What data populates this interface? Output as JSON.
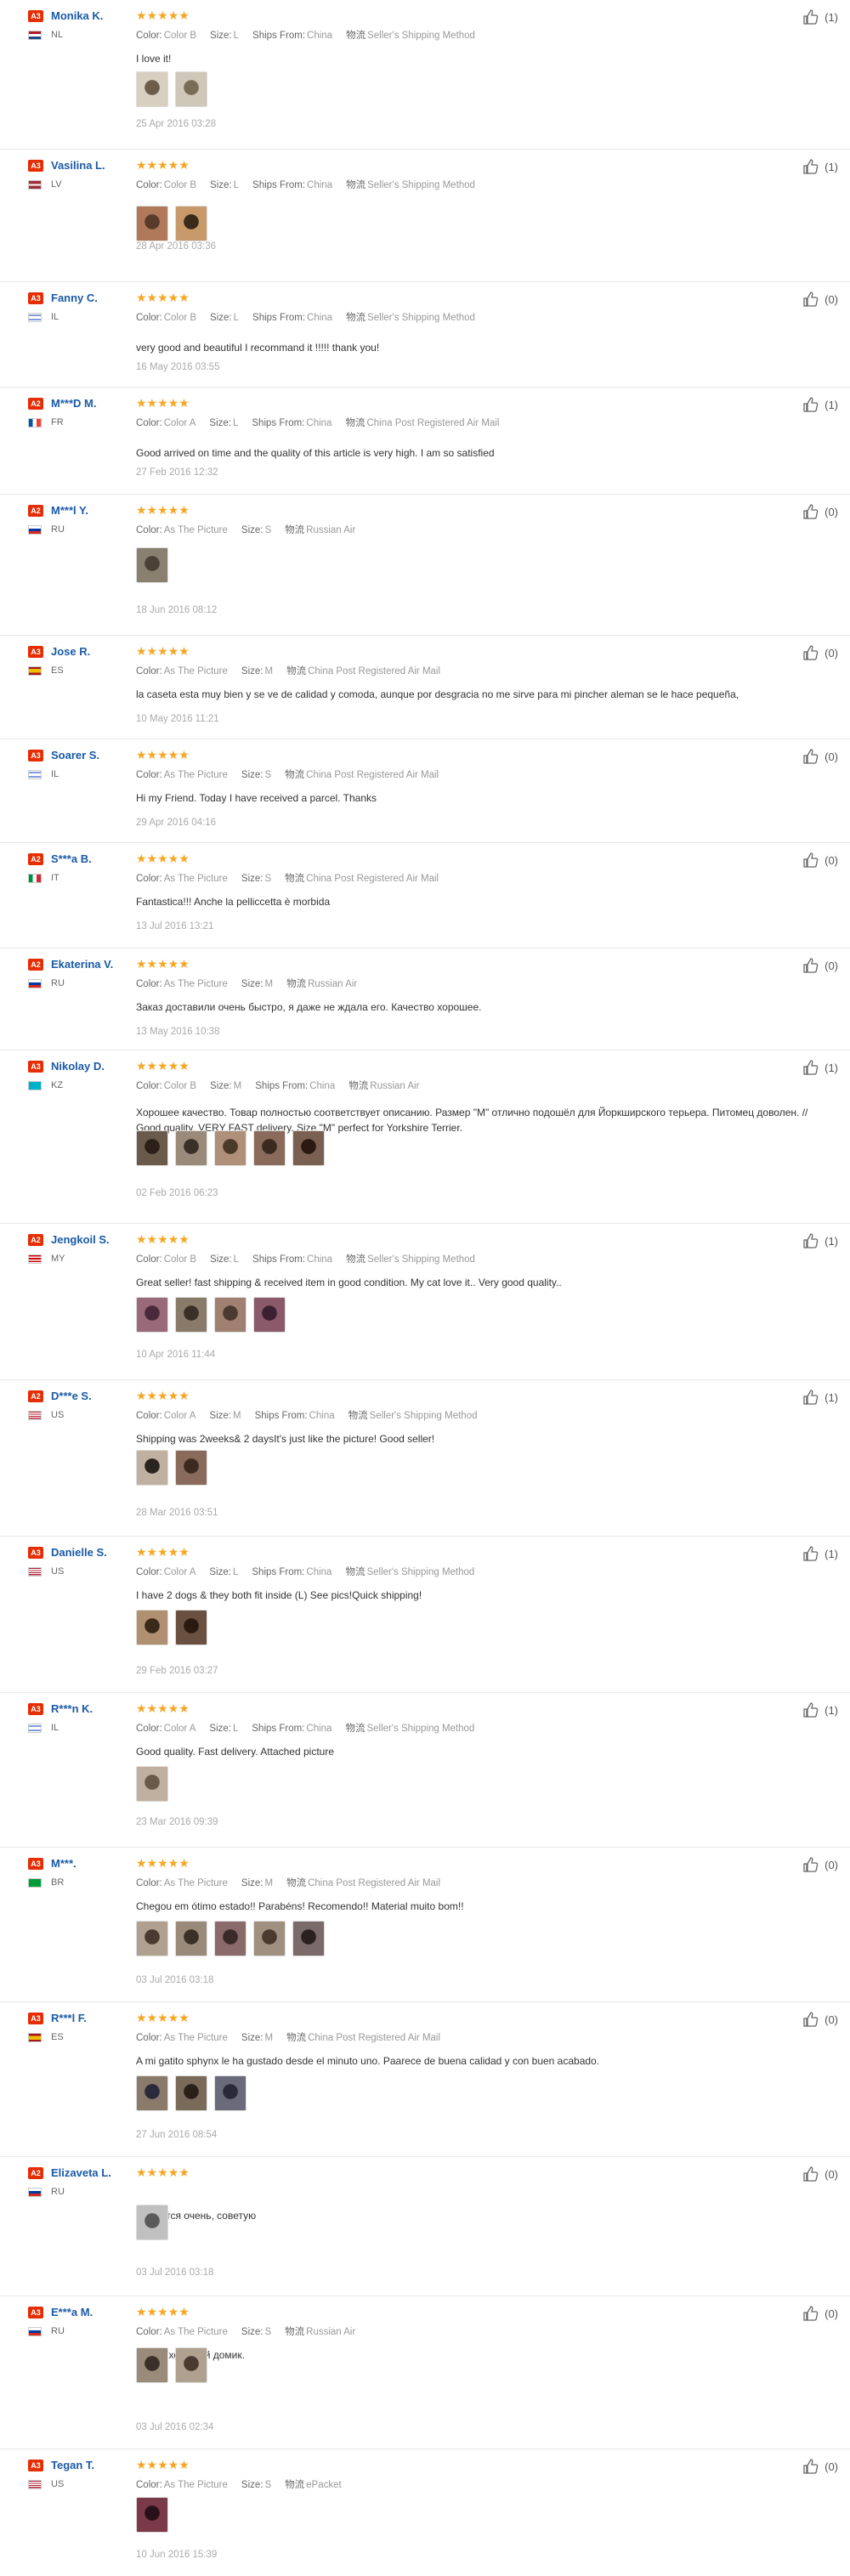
{
  "colors": {
    "badge": "#e62e04",
    "name": "#1a5aa6",
    "star": "#f5a623",
    "meta": "#999999"
  },
  "labels": {
    "color": "Color:",
    "size": "Size:",
    "ships_from": "Ships From:",
    "method_prefix": "物流"
  },
  "reviews": [
    {
      "badge": "A3",
      "name": "Monika K.",
      "country": "NL",
      "flag": "nl",
      "stars": "★★★★★",
      "color": "Color B",
      "size": "L",
      "ships_from": "China",
      "method": "Seller's Shipping Method",
      "text": "I love it!",
      "thumbs": [
        {
          "c1": "#d8cfc1",
          "c2": "#6b5d4a"
        },
        {
          "c1": "#cfc7b8",
          "c2": "#7a6d58"
        }
      ],
      "date": "25 Apr 2016 03:28",
      "helpful": "(1)"
    },
    {
      "badge": "A3",
      "name": "Vasilina L.",
      "country": "LV",
      "flag": "lv",
      "stars": "★★★★★",
      "color": "Color B",
      "size": "L",
      "ships_from": "China",
      "method": "Seller's Shipping Method",
      "text": "",
      "thumbs": [
        {
          "c1": "#b07a5a",
          "c2": "#5a3a2a"
        },
        {
          "c1": "#c89a6a",
          "c2": "#3a2a1a"
        }
      ],
      "date": "28 Apr 2016 03:36",
      "helpful": "(1)"
    },
    {
      "badge": "A3",
      "name": "Fanny C.",
      "country": "IL",
      "flag": "il",
      "stars": "★★★★★",
      "color": "Color B",
      "size": "L",
      "ships_from": "China",
      "method": "Seller's Shipping Method",
      "text": "very good and beautiful I recommand it !!!!! thank you!",
      "thumbs": [],
      "date": "16 May 2016 03:55",
      "helpful": "(0)"
    },
    {
      "badge": "A2",
      "name": "M***D M.",
      "country": "FR",
      "flag": "fr",
      "stars": "★★★★★",
      "color": "Color A",
      "size": "L",
      "ships_from": "China",
      "method": "China Post Registered Air Mail",
      "text": "Good arrived on time and the quality of this article is very high. I am so satisfied",
      "thumbs": [],
      "date": "27 Feb 2016 12:32",
      "helpful": "(1)"
    },
    {
      "badge": "A2",
      "name": "M***l Y.",
      "country": "RU",
      "flag": "ru",
      "stars": "★★★★★",
      "color": "As The Picture",
      "size": "S",
      "ships_from": "",
      "method": "Russian Air",
      "text": "",
      "thumbs": [
        {
          "c1": "#8a8070",
          "c2": "#4a4036"
        }
      ],
      "date": "18 Jun 2016 08:12",
      "helpful": "(0)"
    },
    {
      "badge": "A3",
      "name": "Jose R.",
      "country": "ES",
      "flag": "es",
      "stars": "★★★★★",
      "color": "As The Picture",
      "size": "M",
      "ships_from": "",
      "method": "China Post Registered Air Mail",
      "text": "la caseta esta muy bien y se ve de calidad y comoda, aunque por desgracia no me sirve para mi pincher aleman se le hace pequeña,",
      "thumbs": [],
      "date": "10 May 2016 11:21",
      "helpful": "(0)"
    },
    {
      "badge": "A3",
      "name": "Soarer S.",
      "country": "IL",
      "flag": "il",
      "stars": "★★★★★",
      "color": "As The Picture",
      "size": "S",
      "ships_from": "",
      "method": "China Post Registered Air Mail",
      "text": "Hi my Friend. Today I have received a parcel. Thanks",
      "thumbs": [],
      "date": "29 Apr 2016 04:16",
      "helpful": "(0)"
    },
    {
      "badge": "A2",
      "name": "S***a B.",
      "country": "IT",
      "flag": "it",
      "stars": "★★★★★",
      "color": "As The Picture",
      "size": "S",
      "ships_from": "",
      "method": "China Post Registered Air Mail",
      "text": "Fantastica!!! Anche la pelliccetta è morbida",
      "thumbs": [],
      "date": "13 Jul 2016 13:21",
      "helpful": "(0)"
    },
    {
      "badge": "A2",
      "name": "Ekaterina V.",
      "country": "RU",
      "flag": "ru",
      "stars": "★★★★★",
      "color": "As The Picture",
      "size": "M",
      "ships_from": "",
      "method": "Russian Air",
      "text": "Заказ доставили очень быстро, я даже не ждала его. Качество хорошее.",
      "thumbs": [],
      "date": "13 May 2016 10:38",
      "helpful": "(0)"
    },
    {
      "badge": "A3",
      "name": "Nikolay D.",
      "country": "KZ",
      "flag": "kz",
      "stars": "★★★★★",
      "color": "Color B",
      "size": "M",
      "ships_from": "China",
      "method": "Russian Air",
      "text": "Хорошее качество. Товар полностью соответствует описанию. Размер \"M\" отлично подошёл для Йоркширского терьера. Питомец доволен. // Good quality. VERY FAST delivery. Size \"M\" perfect for Yorkshire Terrier.",
      "thumbs": [
        {
          "c1": "#6a5a4a",
          "c2": "#2a2018"
        },
        {
          "c1": "#9a8a7a",
          "c2": "#3a3028"
        },
        {
          "c1": "#b0907a",
          "c2": "#4a3a2a"
        },
        {
          "c1": "#8a6a5a",
          "c2": "#3a2a20"
        },
        {
          "c1": "#7a6050",
          "c2": "#2a1a12"
        }
      ],
      "date": "02 Feb 2016 06:23",
      "helpful": "(1)"
    },
    {
      "badge": "A2",
      "name": "Jengkoil S.",
      "country": "MY",
      "flag": "my",
      "stars": "★★★★★",
      "color": "Color B",
      "size": "L",
      "ships_from": "China",
      "method": "Seller's Shipping Method",
      "text": "Great seller! fast shipping & received item in good condition. My cat love it.. Very good quality..",
      "thumbs": [
        {
          "c1": "#9a6a7a",
          "c2": "#4a2a3a"
        },
        {
          "c1": "#8a7a6a",
          "c2": "#3a3028"
        },
        {
          "c1": "#a08070",
          "c2": "#4a3a30"
        },
        {
          "c1": "#8a5a6a",
          "c2": "#3a2030"
        }
      ],
      "date": "10 Apr 2016 11:44",
      "helpful": "(1)"
    },
    {
      "badge": "A2",
      "name": "D***e S.",
      "country": "US",
      "flag": "us",
      "stars": "★★★★★",
      "color": "Color A",
      "size": "M",
      "ships_from": "China",
      "method": "Seller's Shipping Method",
      "text": "Shipping was 2weeks& 2 daysIt's just like the picture! Good seller!",
      "thumbs": [
        {
          "c1": "#c0b0a0",
          "c2": "#2a2420"
        },
        {
          "c1": "#8a6a5a",
          "c2": "#3a2a20"
        }
      ],
      "date": "28 Mar 2016 03:51",
      "helpful": "(1)"
    },
    {
      "badge": "A3",
      "name": "Danielle S.",
      "country": "US",
      "flag": "us",
      "stars": "★★★★★",
      "color": "Color A",
      "size": "L",
      "ships_from": "China",
      "method": "Seller's Shipping Method",
      "text": "I have 2 dogs & they both fit inside (L) See pics!Quick shipping!",
      "thumbs": [
        {
          "c1": "#b09070",
          "c2": "#3a2a1a"
        },
        {
          "c1": "#6a5040",
          "c2": "#2a1a10"
        }
      ],
      "date": "29 Feb 2016 03:27",
      "helpful": "(1)"
    },
    {
      "badge": "A3",
      "name": "R***n K.",
      "country": "IL",
      "flag": "il",
      "stars": "★★★★★",
      "color": "Color A",
      "size": "L",
      "ships_from": "China",
      "method": "Seller's Shipping Method",
      "text": "Good quality. Fast delivery. Attached picture",
      "thumbs": [
        {
          "c1": "#c0b0a0",
          "c2": "#6a5a4a"
        }
      ],
      "date": "23 Mar 2016 09:39",
      "helpful": "(1)"
    },
    {
      "badge": "A3",
      "name": "M***.",
      "country": "BR",
      "flag": "br",
      "stars": "★★★★★",
      "color": "As The Picture",
      "size": "M",
      "ships_from": "",
      "method": "China Post Registered Air Mail",
      "text": "Chegou em ótimo estado!! Parabéns! Recomendo!! Material muito bom!!",
      "thumbs": [
        {
          "c1": "#b0a090",
          "c2": "#4a3a30"
        },
        {
          "c1": "#9a8a7a",
          "c2": "#3a3028"
        },
        {
          "c1": "#8a6a6a",
          "c2": "#3a2a2a"
        },
        {
          "c1": "#a09080",
          "c2": "#4a3a30"
        },
        {
          "c1": "#7a6a6a",
          "c2": "#2a2020"
        }
      ],
      "date": "03 Jul 2016 03:18",
      "helpful": "(0)"
    },
    {
      "badge": "A3",
      "name": "R***l F.",
      "country": "ES",
      "flag": "es",
      "stars": "★★★★★",
      "color": "As The Picture",
      "size": "M",
      "ships_from": "",
      "method": "China Post Registered Air Mail",
      "text": "A mi gatito sphynx le ha gustado desde el minuto uno. Paarece de buena calidad y con buen acabado.",
      "thumbs": [
        {
          "c1": "#8a7a6a",
          "c2": "#2a2a3a"
        },
        {
          "c1": "#7a6a5a",
          "c2": "#2a2018"
        },
        {
          "c1": "#6a6a7a",
          "c2": "#2a2a3a"
        }
      ],
      "date": "27 Jun 2016 08:54",
      "helpful": "(0)"
    },
    {
      "badge": "A2",
      "name": "Elizaveta L.",
      "country": "RU",
      "flag": "ru",
      "stars": "★★★★★",
      "color": "",
      "size": "",
      "ships_from": "",
      "method": "",
      "text": "Нравится очень, советую",
      "thumbs": [
        {
          "c1": "#c0c0c0",
          "c2": "#5a5a5a"
        }
      ],
      "date": "03 Jul 2016 03:18",
      "helpful": "(0)"
    },
    {
      "badge": "A3",
      "name": "E***a M.",
      "country": "RU",
      "flag": "ru",
      "stars": "★★★★★",
      "color": "As The Picture",
      "size": "S",
      "ships_from": "",
      "method": "Russian Air",
      "text": "Очень хороший домик.",
      "thumbs": [
        {
          "c1": "#9a8a7a",
          "c2": "#3a3028"
        },
        {
          "c1": "#b0a090",
          "c2": "#4a3a30"
        }
      ],
      "date": "03 Jul 2016 02:34",
      "helpful": "(0)"
    },
    {
      "badge": "A3",
      "name": "Tegan T.",
      "country": "US",
      "flag": "us",
      "stars": "★★★★★",
      "color": "As The Picture",
      "size": "S",
      "ships_from": "",
      "method": "ePacket",
      "text": "",
      "thumbs": [
        {
          "c1": "#7a3a4a",
          "c2": "#2a1018"
        }
      ],
      "date": "10 Jun 2016 15:39",
      "helpful": "(0)"
    }
  ]
}
